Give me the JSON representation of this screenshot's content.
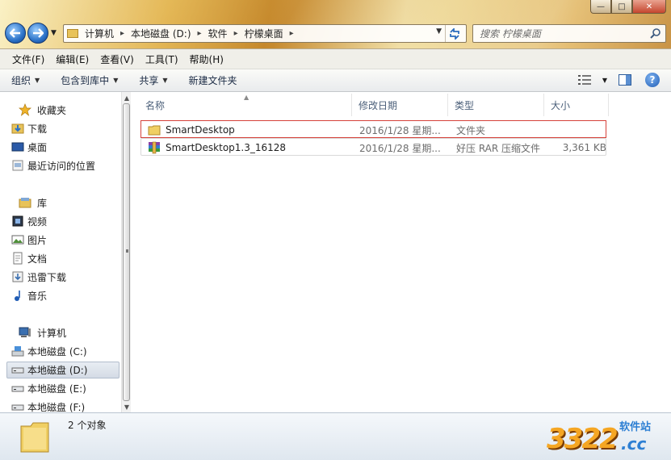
{
  "window": {
    "buttons": {
      "minimize": "—",
      "maximize": "□",
      "close": "✕"
    }
  },
  "navigation": {
    "back_icon": "back-arrow-icon",
    "forward_icon": "forward-arrow-icon"
  },
  "address": {
    "crumbs": [
      "计算机",
      "本地磁盘 (D:)",
      "软件",
      "柠檬桌面"
    ]
  },
  "search": {
    "placeholder": "搜索 柠檬桌面"
  },
  "menu": {
    "items": [
      "文件(F)",
      "编辑(E)",
      "查看(V)",
      "工具(T)",
      "帮助(H)"
    ]
  },
  "toolbar": {
    "organize": "组织",
    "include_in_library": "包含到库中",
    "share": "共享",
    "new_folder": "新建文件夹"
  },
  "sidebar": {
    "favorites": {
      "label": "收藏夹",
      "items": [
        "下载",
        "桌面",
        "最近访问的位置"
      ]
    },
    "libraries": {
      "label": "库",
      "items": [
        "视频",
        "图片",
        "文档",
        "迅雷下载",
        "音乐"
      ]
    },
    "computer": {
      "label": "计算机",
      "items": [
        "本地磁盘 (C:)",
        "本地磁盘 (D:)",
        "本地磁盘 (E:)",
        "本地磁盘 (F:)"
      ],
      "selected": "本地磁盘 (D:)"
    }
  },
  "file_list": {
    "columns": [
      "名称",
      "修改日期",
      "类型",
      "大小"
    ],
    "rows": [
      {
        "name": "SmartDesktop",
        "date": "2016/1/28 星期...",
        "type": "文件夹",
        "size": ""
      },
      {
        "name": "SmartDesktop1.3_16128",
        "date": "2016/1/28 星期...",
        "type": "好压 RAR 压缩文件",
        "size": "3,361 KB"
      }
    ]
  },
  "details": {
    "count_text": "2 个对象"
  },
  "watermark": {
    "number": "3322",
    "suffix": ".cc",
    "top": "软件站"
  },
  "colors": {
    "selection_border": "#d6413a",
    "accent_blue": "#2b72c8",
    "watermark_orange": "#f5a623"
  }
}
